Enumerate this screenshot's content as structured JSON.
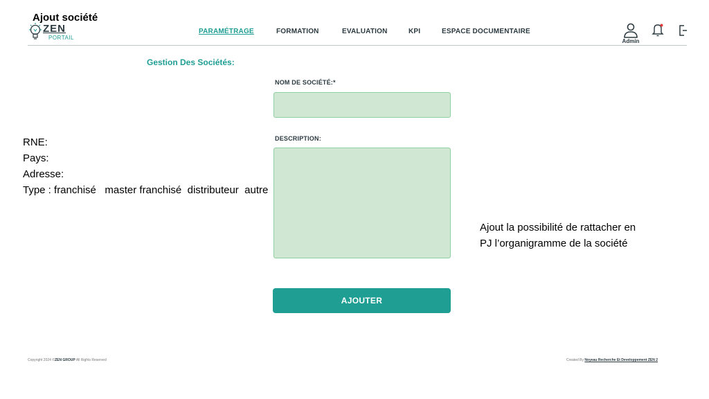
{
  "slide": {
    "title": "Ajout société"
  },
  "brand": {
    "name": "ZEN",
    "sub": "PORTAIL",
    "accent": "#1f9e94",
    "dark": "#2b3a40",
    "field_bg": "#d0e8d3"
  },
  "nav": {
    "items": [
      {
        "label": "PARAMÉTRAGE",
        "active": true
      },
      {
        "label": "FORMATION",
        "active": false
      },
      {
        "label": "EVALUATION",
        "active": false
      },
      {
        "label": "KPI",
        "active": false
      },
      {
        "label": "ESPACE DOCUMENTAIRE",
        "active": false
      }
    ]
  },
  "user": {
    "label": "Admin",
    "icons": [
      "user-icon",
      "bell-icon",
      "logout-icon"
    ]
  },
  "form": {
    "section_title": "Gestion Des Sociétés:",
    "company_name_label": "NOM DE SOCIÉTÉ:*",
    "company_name_value": "",
    "description_label": "DESCRIPTION:",
    "description_value": "",
    "submit_label": "AJOUTER"
  },
  "annotations": {
    "left_lines": [
      "RNE:",
      "Pays:",
      "Adresse:",
      "Type : franchisé   master franchisé  distributeur  autre"
    ],
    "right_text": "Ajout la possibilité de rattacher en PJ l’organigramme de la société"
  },
  "footer": {
    "copyright_prefix": "Copyright 2024 ©",
    "copyright_brand": "ZEN GROUP",
    "copyright_suffix": " All Rights Reserved",
    "credit_prefix": "Created By ",
    "credit_link": "Noyeau Recherche Et Developpement ZEN 2"
  }
}
